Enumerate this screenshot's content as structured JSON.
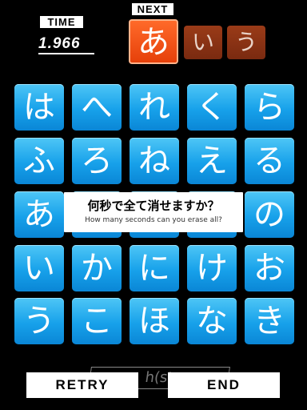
{
  "header": {
    "time_label": "TIME",
    "time_value": "1.966",
    "next_label": "NEXT"
  },
  "next_queue": [
    "あ",
    "い",
    "う"
  ],
  "grid": {
    "rows": [
      [
        "は",
        "へ",
        "れ",
        "く",
        "ら"
      ],
      [
        "ふ",
        "ろ",
        "ね",
        "え",
        "る"
      ],
      [
        "あ",
        "",
        "",
        "",
        "の"
      ],
      [
        "い",
        "か",
        "に",
        "け",
        "お"
      ],
      [
        "う",
        "こ",
        "ほ",
        "な",
        "き"
      ]
    ]
  },
  "dialog": {
    "question_ja": "何秒で全て消せますか？",
    "question_en": "How many seconds can you erase all?"
  },
  "hidden_text": "h(st",
  "buttons": {
    "retry": "RETRY",
    "end": "END"
  },
  "colors": {
    "background": "#000000",
    "tile": "#1aa3eb",
    "next_active": "#f0541a",
    "next_inactive": "#8a3315"
  }
}
